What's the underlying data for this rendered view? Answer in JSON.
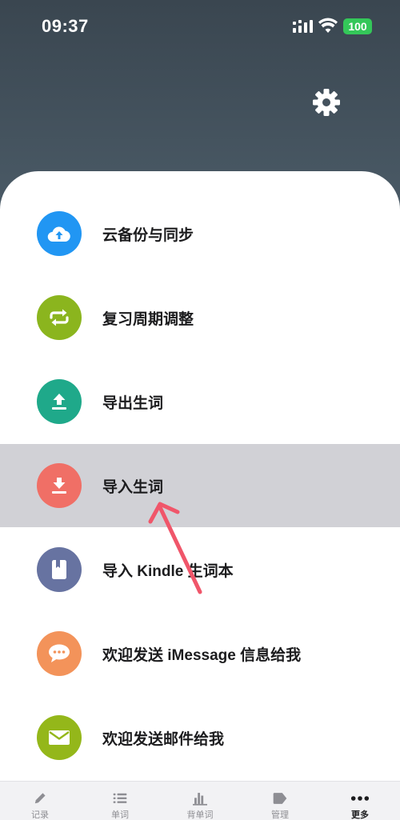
{
  "status_bar": {
    "time": "09:37",
    "battery": "100"
  },
  "menu": {
    "items": [
      {
        "label": "云备份与同步",
        "icon": "cloud-upload-icon",
        "color": "#2196f3"
      },
      {
        "label": "复习周期调整",
        "icon": "repeat-icon",
        "color": "#8bb51e"
      },
      {
        "label": "导出生词",
        "icon": "export-icon",
        "color": "#1fa98a"
      },
      {
        "label": "导入生词",
        "icon": "import-icon",
        "color": "#f06f66",
        "selected": true
      },
      {
        "label": "导入 Kindle 生词本",
        "icon": "book-icon",
        "color": "#6773a1"
      },
      {
        "label": "欢迎发送 iMessage 信息给我",
        "icon": "chat-icon",
        "color": "#f3935a"
      },
      {
        "label": "欢迎发送邮件给我",
        "icon": "mail-icon",
        "color": "#94b71a"
      }
    ]
  },
  "tabbar": {
    "tabs": [
      {
        "label": "记录",
        "icon": "pencil-icon"
      },
      {
        "label": "单词",
        "icon": "list-icon"
      },
      {
        "label": "背单词",
        "icon": "bar-chart-icon"
      },
      {
        "label": "管理",
        "icon": "tag-icon"
      },
      {
        "label": "更多",
        "icon": "more-icon",
        "selected": true
      }
    ]
  },
  "colors": {
    "header": "#3f4b55",
    "selected_row": "#d1d1d6",
    "annotation_arrow": "#f0566a"
  }
}
